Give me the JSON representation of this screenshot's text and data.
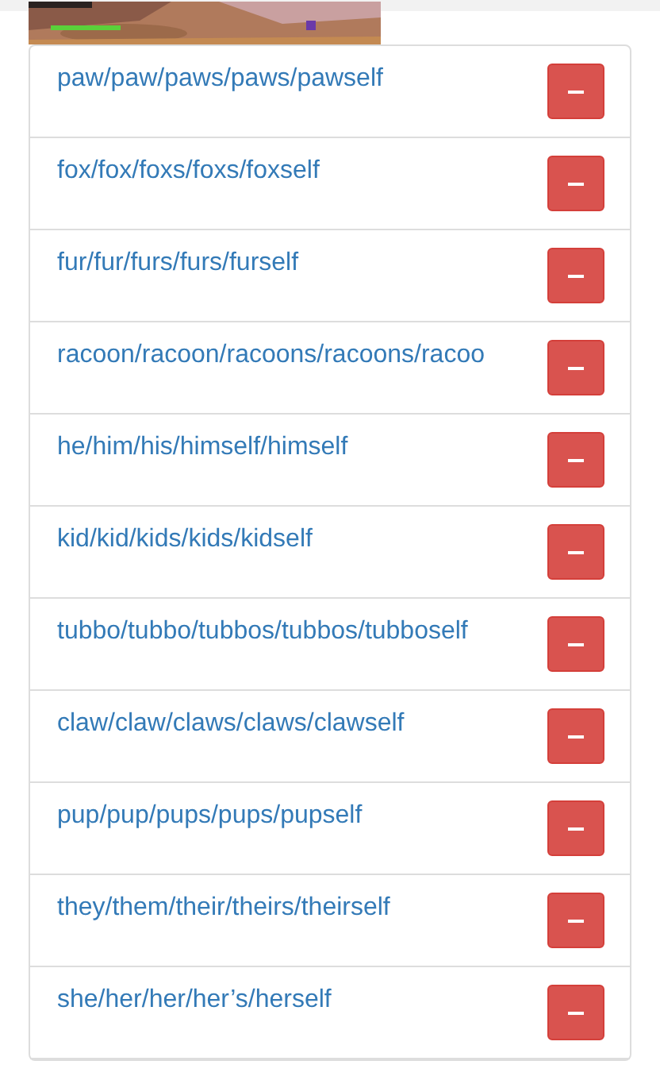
{
  "pronouns": [
    {
      "label": "paw/paw/paws/paws/pawself"
    },
    {
      "label": "fox/fox/foxs/foxs/foxself"
    },
    {
      "label": "fur/fur/furs/furs/furself"
    },
    {
      "label": "racoon/racoon/racoons/racoons/racoo"
    },
    {
      "label": "he/him/his/himself/himself"
    },
    {
      "label": "kid/kid/kids/kids/kidself"
    },
    {
      "label": "tubbo/tubbo/tubbos/tubbos/tubboself"
    },
    {
      "label": "claw/claw/claws/claws/clawself"
    },
    {
      "label": "pup/pup/pups/pups/pupself"
    },
    {
      "label": "they/them/their/theirs/theirself"
    },
    {
      "label": "she/her/her/her’s/herself"
    }
  ]
}
